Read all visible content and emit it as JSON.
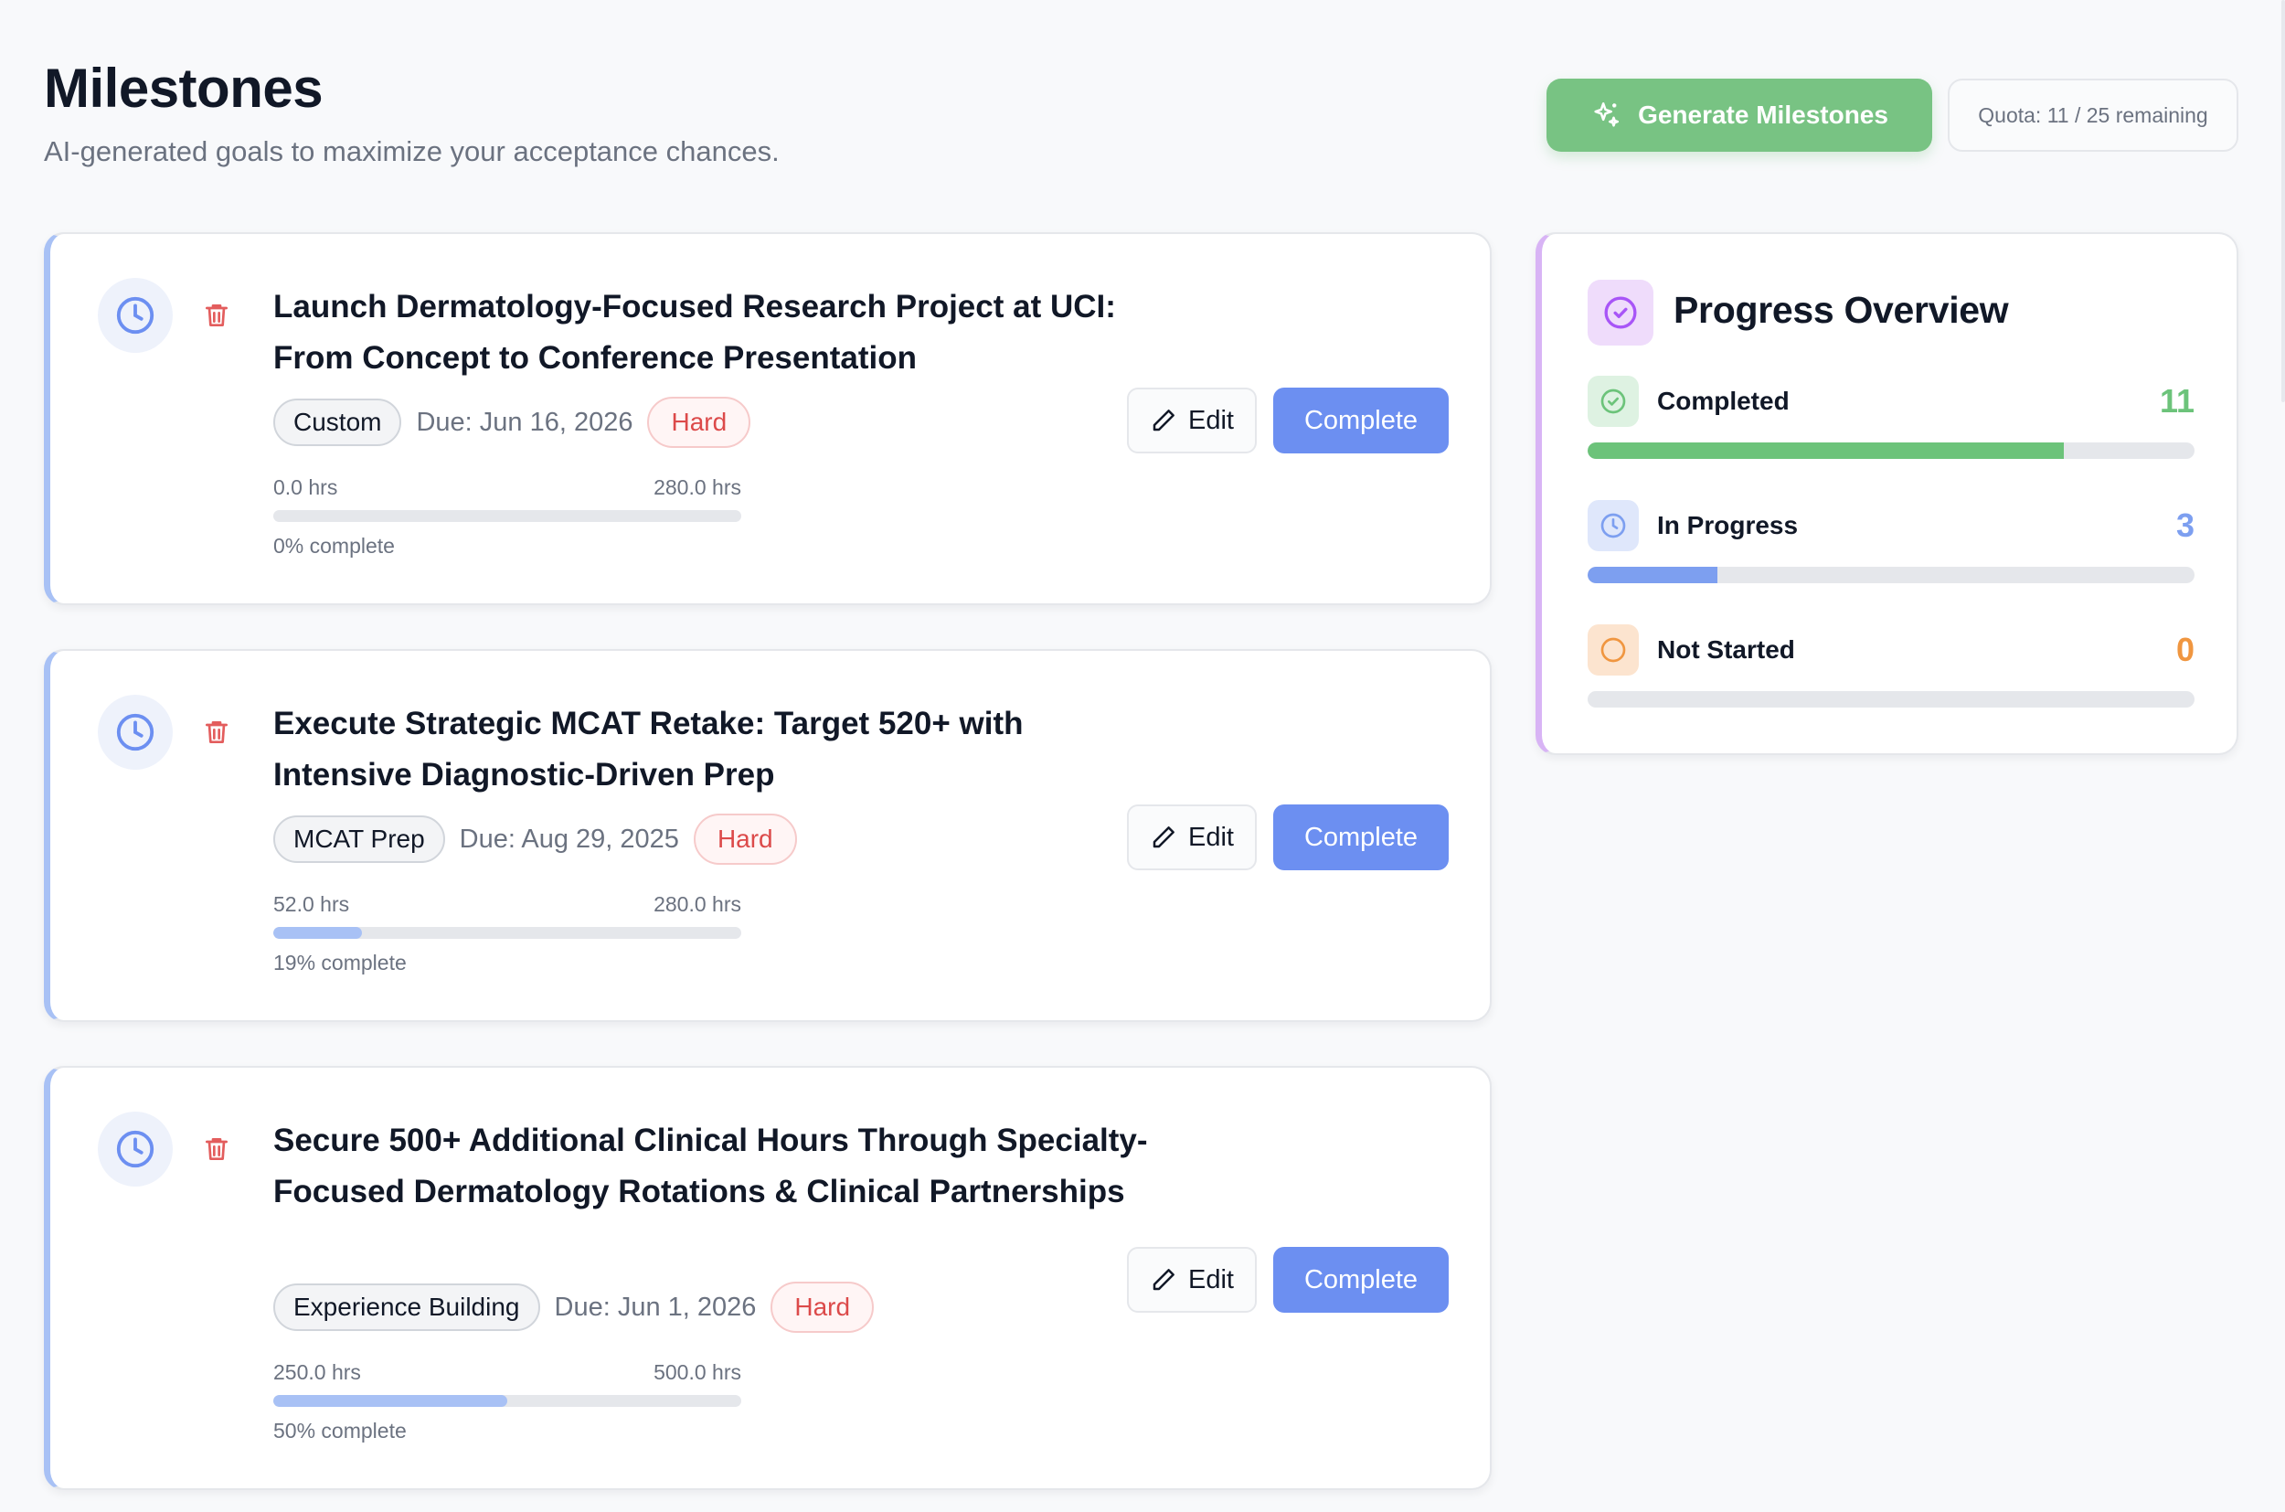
{
  "header": {
    "title": "Milestones",
    "subtitle": "AI-generated goals to maximize your acceptance chances.",
    "generate_label": "Generate Milestones",
    "quota": "Quota: 11 / 25 remaining"
  },
  "milestones": [
    {
      "title": "Launch Dermatology-Focused Research Project at UCI: From Concept to Conference Presentation",
      "category": "Custom",
      "due": "Due: Jun 16, 2026",
      "difficulty": "Hard",
      "hours_done": "0.0 hrs",
      "hours_total": "280.0 hrs",
      "percent_text": "0% complete",
      "progress": 0,
      "edit_label": "Edit",
      "complete_label": "Complete"
    },
    {
      "title": "Execute Strategic MCAT Retake: Target 520+ with Intensive Diagnostic-Driven Prep",
      "category": "MCAT Prep",
      "due": "Due: Aug 29, 2025",
      "difficulty": "Hard",
      "hours_done": "52.0 hrs",
      "hours_total": "280.0 hrs",
      "percent_text": "19% complete",
      "progress": 0.19,
      "edit_label": "Edit",
      "complete_label": "Complete"
    },
    {
      "title": "Secure 500+ Additional Clinical Hours Through Specialty-Focused Dermatology Rotations & Clinical Partnerships",
      "category": "Experience Building",
      "due": "Due: Jun 1, 2026",
      "difficulty": "Hard",
      "hours_done": "250.0 hrs",
      "hours_total": "500.0 hrs",
      "percent_text": "50% complete",
      "progress": 0.5,
      "edit_label": "Edit",
      "complete_label": "Complete"
    }
  ],
  "overview": {
    "title": "Progress Overview",
    "stats": [
      {
        "label": "Completed",
        "value": "11",
        "fraction": 0.785,
        "color": "#6cc37a",
        "icon_bg": "#def2e2",
        "icon": "check-circle-icon"
      },
      {
        "label": "In Progress",
        "value": "3",
        "fraction": 0.214,
        "color": "#7d9ff0",
        "icon_bg": "#dfe7fb",
        "icon": "clock-icon"
      },
      {
        "label": "Not Started",
        "value": "0",
        "fraction": 0,
        "color": "#f09640",
        "icon_bg": "#fce4cf",
        "icon": "circle-icon"
      }
    ]
  },
  "colors": {
    "accent_blue": "#6c8ff1",
    "green": "#78c383",
    "hard_red": "#dc4a4a",
    "card_accent": "#a8c1f5",
    "overview_accent": "#d8b4f5"
  }
}
